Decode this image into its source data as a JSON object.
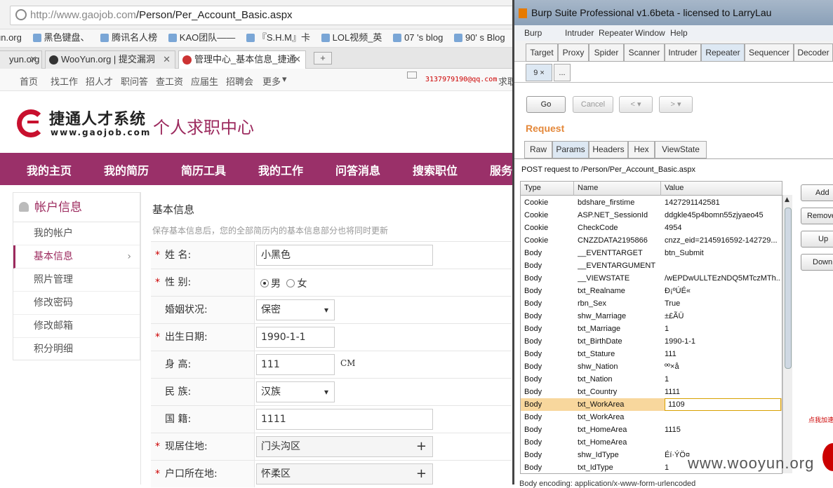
{
  "browser": {
    "url_host": "http://www.gaojob.com",
    "url_path": "/Person/Per_Account_Basic.aspx",
    "bookmarks": [
      "un.org",
      "黑色键盘、",
      "腾讯名人榜",
      "KAO团队——",
      "『S.H.M』卡",
      "LOL视频_英",
      "07 's blog",
      "90' s Blog"
    ],
    "tabs": [
      {
        "label": "yun.org",
        "active": false
      },
      {
        "label": "WooYun.org | 提交漏洞",
        "active": false
      },
      {
        "label": "管理中心_基本信息_捷通",
        "active": true
      }
    ],
    "close_glyph": "✕",
    "newtab_glyph": "+"
  },
  "site": {
    "topnav": [
      "首页",
      "找工作",
      "招人才",
      "职问答",
      "查工资",
      "应届生",
      "招聘会",
      "更多"
    ],
    "more_glyph": "▾",
    "email": "3137979190@qq.com",
    "job_text": "求职",
    "logo_cn": "捷通人才系统",
    "logo_en": "www.gaojob.com",
    "logo_sub": "个人求职中心",
    "mainnav": [
      "我的主页",
      "我的简历",
      "简历工具",
      "我的工作",
      "问答消息",
      "搜索职位",
      "服务"
    ],
    "sidebar_title": "帐户信息",
    "sidebar_items": [
      "我的帐户",
      "基本信息",
      "照片管理",
      "修改密码",
      "修改邮箱",
      "积分明细"
    ],
    "sidebar_chevron": "›",
    "form_title": "基本信息",
    "form_hint": "保存基本信息后，您的全部简历内的基本信息部分也将同时更新",
    "required_mark": "*",
    "fields": {
      "name_label": "姓  名:",
      "name_value": "小黑色",
      "sex_label": "性  别:",
      "sex_male": "男",
      "sex_female": "女",
      "marriage_label": "婚姻状况:",
      "marriage_value": "保密",
      "birth_label": "出生日期:",
      "birth_value": "1990-1-1",
      "height_label": "身  高:",
      "height_value": "111",
      "height_unit": "CM",
      "nation_label": "民  族:",
      "nation_value": "汉族",
      "country_label": "国  籍:",
      "country_value": "1111",
      "live_label": "现居住地:",
      "live_value": "门头沟区",
      "hukou_label": "户口所在地:",
      "hukou_value": "怀柔区",
      "plus_glyph": "+"
    }
  },
  "burp": {
    "title": "Burp Suite Professional v1.6beta - licensed to LarryLau",
    "menu": [
      "Burp",
      "Intruder",
      "Repeater",
      "Window",
      "Help"
    ],
    "tools": [
      "Target",
      "Proxy",
      "Spider",
      "Scanner",
      "Intruder",
      "Repeater",
      "Sequencer",
      "Decoder"
    ],
    "active_tool": "Repeater",
    "req_tabs": [
      "9 ×",
      "..."
    ],
    "buttons": {
      "go": "Go",
      "cancel": "Cancel",
      "back": "< ▾",
      "forward": "> ▾"
    },
    "request_label": "Request",
    "view_tabs": [
      "Raw",
      "Params",
      "Headers",
      "Hex",
      "ViewState"
    ],
    "active_view": "Params",
    "post_line": "POST request to /Person/Per_Account_Basic.aspx",
    "columns": [
      "Type",
      "Name",
      "Value"
    ],
    "params": [
      [
        "Cookie",
        "bdshare_firstime",
        "1427291142581"
      ],
      [
        "Cookie",
        "ASP.NET_SessionId",
        "ddgkle45p4bomn55zjyaeo45"
      ],
      [
        "Cookie",
        "CheckCode",
        "4954"
      ],
      [
        "Cookie",
        "CNZZDATA2195866",
        "cnzz_eid=2145916592-142729..."
      ],
      [
        "Body",
        "__EVENTTARGET",
        "btn_Submit"
      ],
      [
        "Body",
        "__EVENTARGUMENT",
        ""
      ],
      [
        "Body",
        "__VIEWSTATE",
        "/wEPDwULLTEzNDQ5MTczMTh..."
      ],
      [
        "Body",
        "txt_Realname",
        "Ð¡ºÚÉ«"
      ],
      [
        "Body",
        "rbn_Sex",
        "True"
      ],
      [
        "Body",
        "shw_Marriage",
        "±£ÃÜ"
      ],
      [
        "Body",
        "txt_Marriage",
        "1"
      ],
      [
        "Body",
        "txt_BirthDate",
        "1990-1-1"
      ],
      [
        "Body",
        "txt_Stature",
        "111"
      ],
      [
        "Body",
        "shw_Nation",
        "ºº×å"
      ],
      [
        "Body",
        "txt_Nation",
        "1"
      ],
      [
        "Body",
        "txt_Country",
        "1111"
      ],
      [
        "Body",
        "txt_WorkArea",
        "1109"
      ],
      [
        "Body",
        "txt_WorkArea",
        ""
      ],
      [
        "Body",
        "txt_HomeArea",
        "1115"
      ],
      [
        "Body",
        "txt_HomeArea",
        ""
      ],
      [
        "Body",
        "shw_IdType",
        "Éí·ÝÖ¤"
      ],
      [
        "Body",
        "txt_IdType",
        "1"
      ]
    ],
    "selected_row": 16,
    "side_buttons": [
      "Add",
      "Remove",
      "Up",
      "Down"
    ],
    "scroll_up_glyph": "▲",
    "bottom_text": "Body encoding: application/x-www-form-urlencoded"
  },
  "watermark": "www.wooyun.org",
  "promo_text": "点我加速"
}
